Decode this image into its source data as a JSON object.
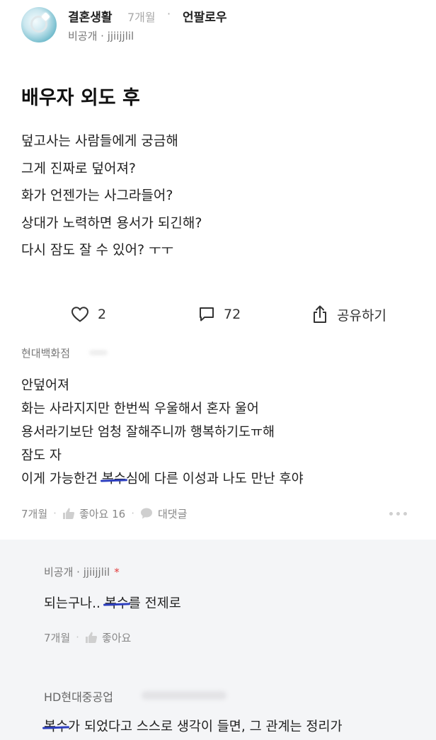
{
  "post": {
    "channel": "결혼생활",
    "time": "7개월",
    "separator": "·",
    "follow_label": "언팔로우",
    "author_line": "비공개 · jjiijjlil",
    "title": "배우자 외도 후",
    "body": [
      "덮고사는 사람들에게 궁금해",
      "그게 진짜로 덮어져?",
      "화가 언젠가는 사그라들어?",
      "상대가 노력하면 용서가 되긴해?",
      "다시 잠도 잘 수 있어? ㅜㅜ"
    ],
    "like_count": "2",
    "comment_count": "72",
    "share_label": "공유하기"
  },
  "comment": {
    "author": "현대백화점",
    "lines": [
      "안덮어져",
      "화는 사라지지만 한번씩 우울해서 혼자 울어",
      "용서라기보단 엄청 잘해주니까 행복하기도ㅠ해",
      "잠도 자"
    ],
    "last_line_prefix": "이게 가능한건 ",
    "last_line_strike": "복수",
    "last_line_suffix": "심에 다른 이성과 나도 만난 후야",
    "time": "7개월",
    "like_label": "좋아요 16",
    "reply_label": "대댓글"
  },
  "replies": [
    {
      "author": "비공개 · jjiijjlil",
      "star": "*",
      "text_prefix": "되는구나.. ",
      "text_strike": "복수",
      "text_suffix": "를 전제로",
      "time": "7개월",
      "like_label": "좋아요"
    },
    {
      "author": "HD현대중공업",
      "text_strike": "복수",
      "text_suffix": "가 되었다고 스스로 생각이 들면, 그 관계는 정리가"
    }
  ],
  "colors": {
    "strike_marker": "#2d3fbf",
    "reply_background": "#f4f5f7",
    "star": "#e23b3b"
  }
}
